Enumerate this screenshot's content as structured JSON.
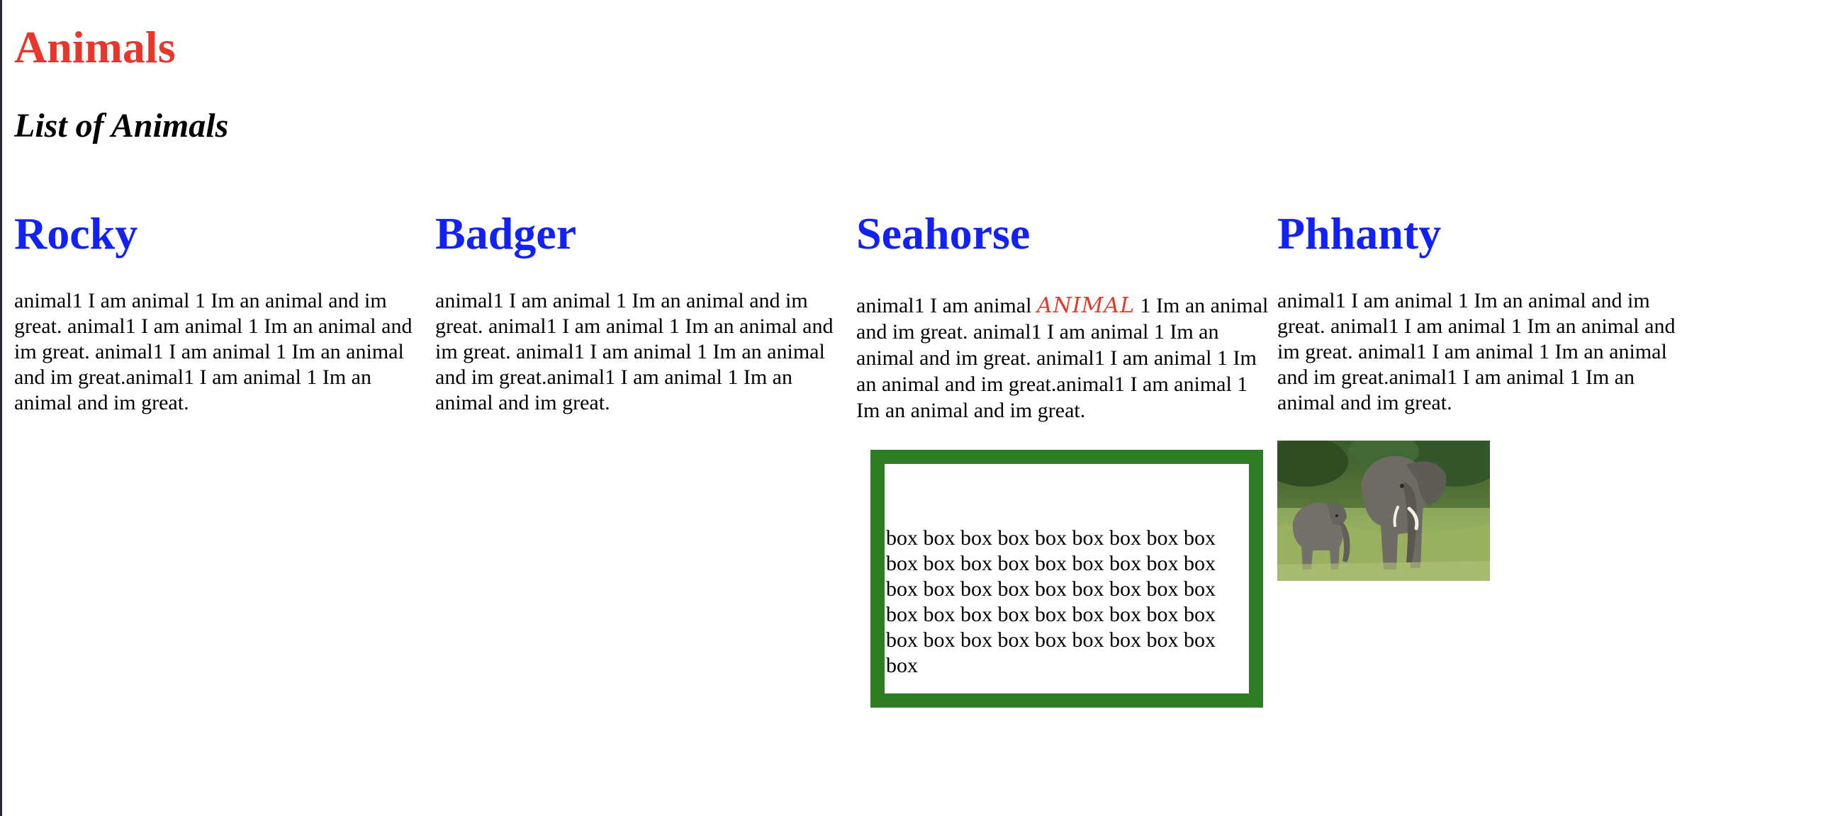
{
  "page": {
    "title": "Animals",
    "subtitle": "List of Animals"
  },
  "colors": {
    "title": "#e8362b",
    "heading": "#1221f5",
    "fancy_word": "#e8362b",
    "box_border": "#2e7d24"
  },
  "columns": [
    {
      "heading": "Rocky",
      "text": "animal1 I am animal 1 Im an animal and im great. animal1 I am animal 1 Im an animal and im great. animal1 I am animal 1 Im an animal and im great.animal1 I am animal 1 Im an animal and im great."
    },
    {
      "heading": "Badger",
      "text": "animal1 I am animal 1 Im an animal and im great. animal1 I am animal 1 Im an animal and im great. animal1 I am animal 1 Im an animal and im great.animal1 I am animal 1 Im an animal and im great."
    },
    {
      "heading": "Seahorse",
      "text_before": "animal1 I am animal ",
      "text_fancy": "ANIMAL",
      "text_after": " 1 Im an animal and im great. animal1 I am animal 1 Im an animal and im great. animal1 I am animal 1 Im an animal and im great.animal1 I am animal 1 Im an animal and im great.",
      "box_text": "box box box box box box box box box box box box box box box box box box box box box box box box box box box box box box box box box box box box box box box box box box box box box box"
    },
    {
      "heading": "Phhanty",
      "text": "animal1 I am animal 1 Im an animal and im great. animal1 I am animal 1 Im an animal and im great. animal1 I am animal 1 Im an animal and im great.animal1 I am animal 1 Im an animal and im great.",
      "image": "elephants-photo"
    }
  ]
}
